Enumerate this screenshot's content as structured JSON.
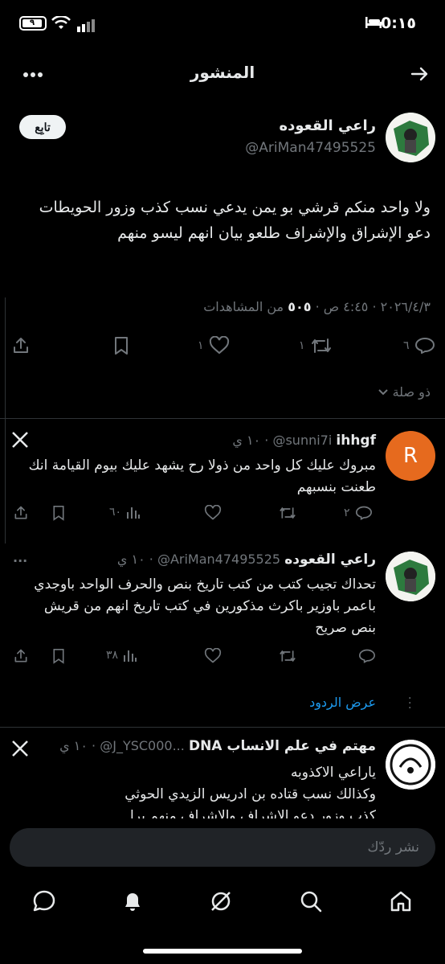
{
  "status_bar": {
    "time": "0:١٥",
    "battery": "٩"
  },
  "header": {
    "title": "المنشور"
  },
  "main_tweet": {
    "author_name": "راعي القعوده",
    "author_handle": "@AriMan47495525",
    "follow_label": "تابِع",
    "text": "ولا واحد منكم قرشي بو يمن يدعي نسب كذب وزور الحويطات دعو الإشراق  والإشراف طلعو بيان انهم ليسو منهم",
    "date": "٢٠٢٦/٤/٣",
    "time": "٤:٤٥ ص",
    "views_count": "٥٠٥",
    "views_label": "من المشاهدات",
    "replies": "٦",
    "reposts": "١",
    "likes": "١"
  },
  "thread_link": "ذو صلة",
  "replies": [
    {
      "avatar_letter": "R",
      "name": "ihhgf",
      "handle": "@sunni7i",
      "time": "١٠ ي",
      "text": "مبروك عليك كل واحد من ذولا رح يشهد عليك بيوم القيامة انك طعنت بنسبهم",
      "replies": "٢",
      "reposts": "",
      "likes": "",
      "views": "٦٠"
    },
    {
      "name": "راعي القعوده",
      "handle": "@AriMan47495525",
      "time": "١٠ ي",
      "text": "تحداك تجيب كتب من كتب تاريخ بنص والحرف الواحد باوجدي باعمر باوزير باكرث مذكورين في كتب تاريخ انهم من قريش بنص صريح",
      "replies": "",
      "reposts": "",
      "likes": "",
      "views": "٣٨"
    },
    {
      "name": "مهتم في علم الانساب DNA",
      "handle": "@J_YSC000...",
      "time": "١٠ ي",
      "text_lines": [
        "ياراعي الاكذوبه",
        "وكذالك نسب قتاده بن ادريس الزيدي الحوثي",
        "كذب وزور دعو الاشراف والاشراف منهم برا"
      ]
    }
  ],
  "show_replies_label": "عرض الردود",
  "composer": {
    "placeholder": "نشر ردّك"
  },
  "colors": {
    "accent": "#1d9bf0",
    "muted": "#71767b",
    "text": "#e7e9ea"
  }
}
